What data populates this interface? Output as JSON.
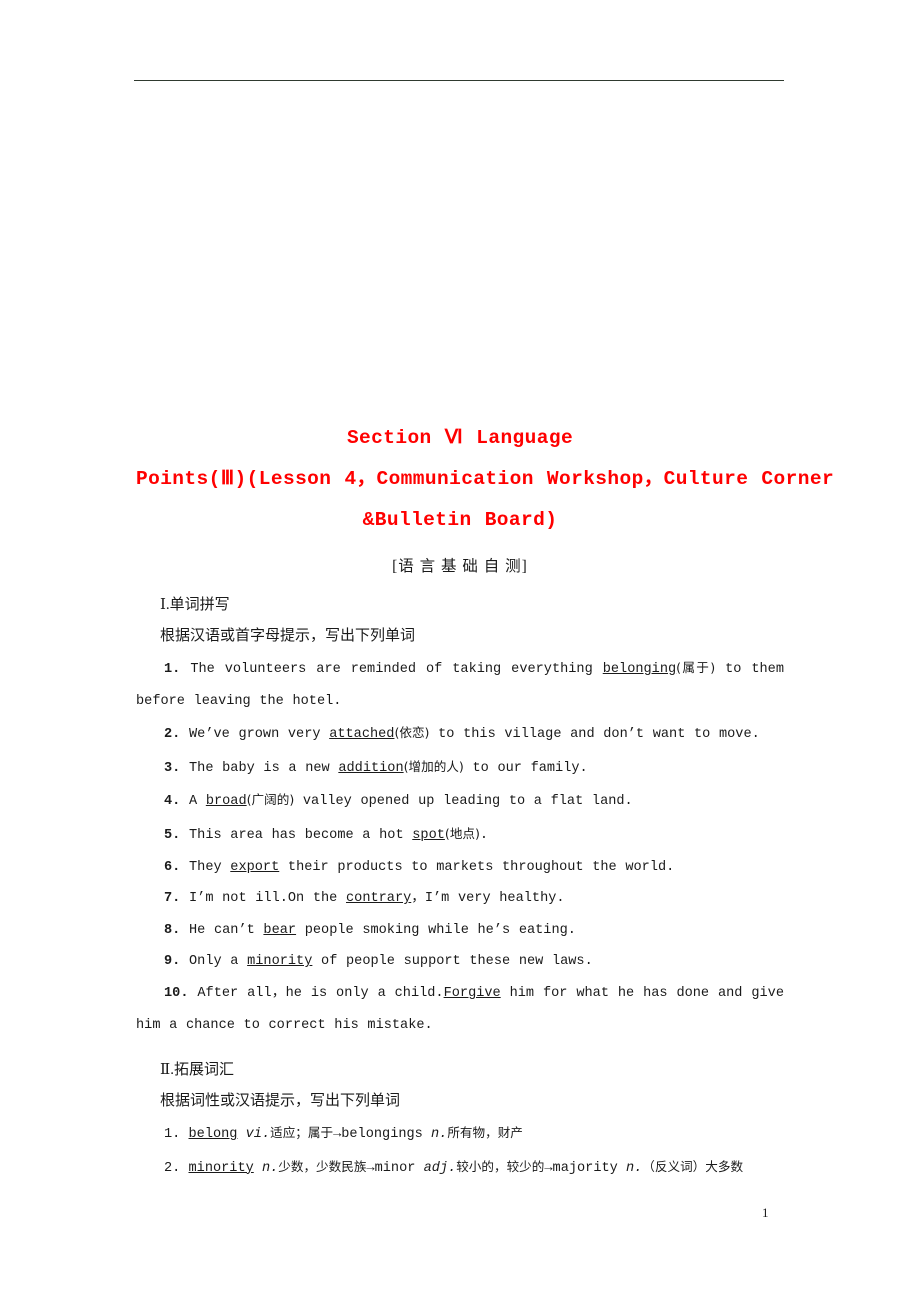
{
  "document": {
    "title_lines": [
      "Section Ⅵ  Language",
      "Points(Ⅲ)(Lesson 4，Communication Workshop，Culture Corner",
      "&Bulletin Board)"
    ],
    "subtitle": "[语 言 基 础 自 测]",
    "page_number": "1",
    "title_color": "#ff0000",
    "rule_color": "#2f3a2f"
  },
  "section_one": {
    "heading": "Ⅰ.单词拼写",
    "instruction": "根据汉语或首字母提示，写出下列单词",
    "items": [
      {
        "num": "1.",
        "pre": "The volunteers are reminded of taking everything ",
        "answer": "belonging",
        "gloss": "(属于)",
        "post": " to them before leaving the hotel."
      },
      {
        "num": "2.",
        "pre": "We’ve grown very ",
        "answer": "attached",
        "gloss": "(依恋)",
        "post": " to this village and don’t want to move."
      },
      {
        "num": "3.",
        "pre": "The baby is a new ",
        "answer": "addition",
        "gloss": "(增加的人)",
        "post": " to our family."
      },
      {
        "num": "4.",
        "pre": "A ",
        "answer": "broad",
        "gloss": "(广阔的)",
        "post": " valley opened up leading to a flat land."
      },
      {
        "num": "5.",
        "pre": "This area has become a hot ",
        "answer": "spot",
        "gloss": "(地点)",
        "post": "."
      },
      {
        "num": "6.",
        "pre": "They ",
        "answer": "export",
        "gloss": "",
        "post": " their products to markets throughout the world."
      },
      {
        "num": "7.",
        "pre": "I’m not ill.On the ",
        "answer": "contrary",
        "gloss": "",
        "post": "，I’m very healthy."
      },
      {
        "num": "8.",
        "pre": "He can’t ",
        "answer": "bear",
        "gloss": "",
        "post": " people smoking while he’s eating."
      },
      {
        "num": "9.",
        "pre": "Only a ",
        "answer": "minority",
        "gloss": "",
        "post": " of people support these new laws."
      },
      {
        "num": "10.",
        "pre": "After all，he is only a child.",
        "answer": "Forgive",
        "gloss": "",
        "post": " him for what he has done and give him a chance to correct his mistake."
      }
    ]
  },
  "section_two": {
    "heading": "Ⅱ.拓展词汇",
    "instruction": "根据词性或汉语提示，写出下列单词",
    "items": [
      {
        "num": "1.",
        "headword": "belong",
        "pos1": "vi.",
        "sense1": "适应；属于",
        "arrow1": "→",
        "derived1": "belongings",
        "pos2": "n.",
        "sense2": "所有物，财产",
        "arrow2": "",
        "derived2": "",
        "pos3": "",
        "sense3": "",
        "tail": ""
      },
      {
        "num": "2.",
        "headword": "minority",
        "pos1": "n.",
        "sense1": "少数，少数民族",
        "arrow1": "→",
        "derived1": "minor",
        "pos2": "adj.",
        "sense2": "较小的，较少的",
        "arrow2": "→",
        "derived2": "majority",
        "pos3": "n.",
        "sense3": "（反义词）大多数",
        "tail": ""
      }
    ]
  }
}
